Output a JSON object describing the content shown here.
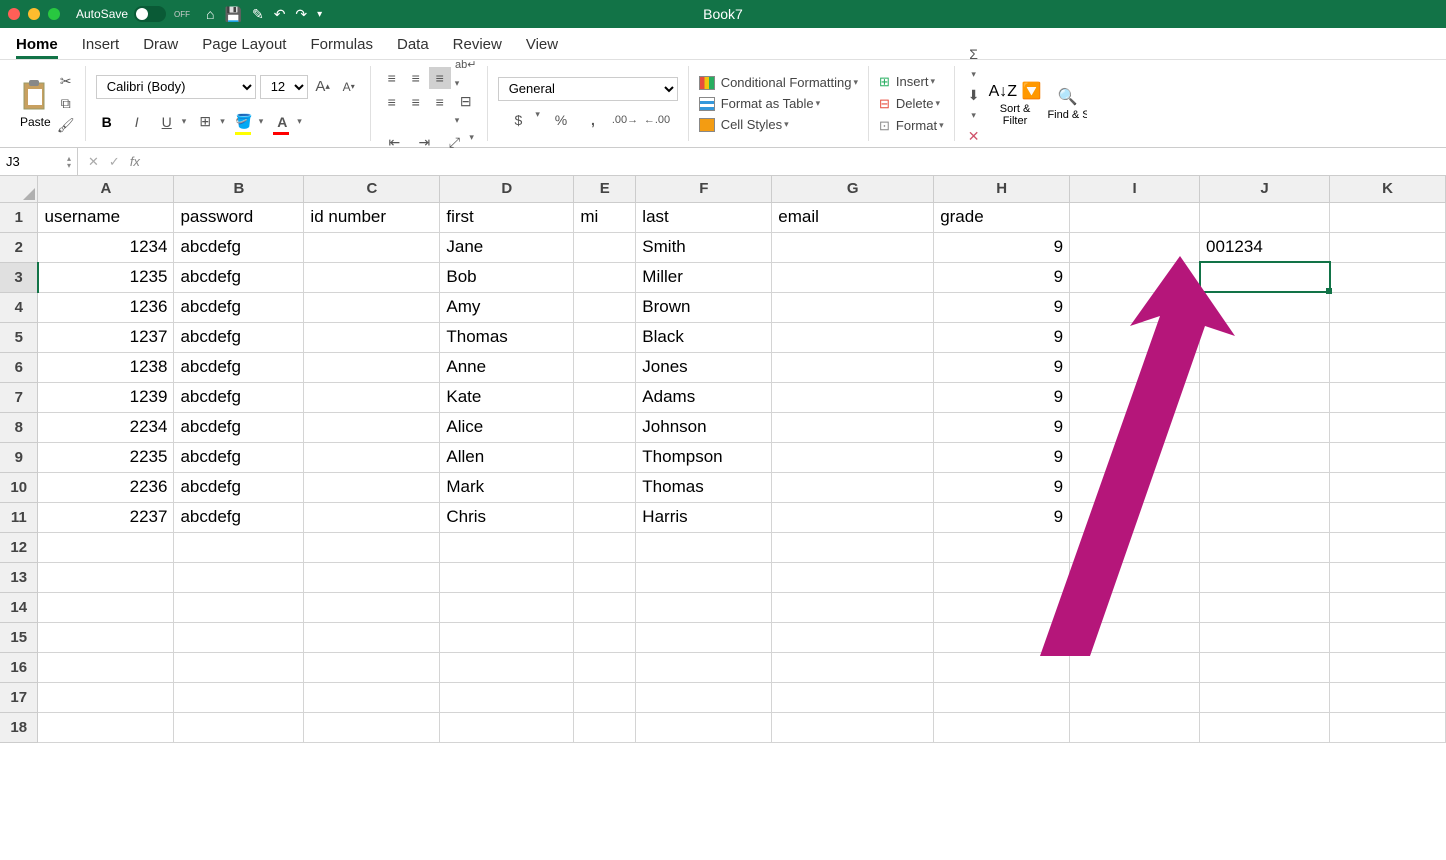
{
  "titlebar": {
    "autosave_label": "AutoSave",
    "autosave_state": "OFF",
    "title": "Book7"
  },
  "tabs": [
    "Home",
    "Insert",
    "Draw",
    "Page Layout",
    "Formulas",
    "Data",
    "Review",
    "View"
  ],
  "active_tab": 0,
  "ribbon": {
    "paste_label": "Paste",
    "font_name": "Calibri (Body)",
    "font_size": "12",
    "number_format": "General",
    "conditional_formatting": "Conditional Formatting",
    "format_as_table": "Format as Table",
    "cell_styles": "Cell Styles",
    "insert": "Insert",
    "delete": "Delete",
    "format": "Format",
    "sort_filter": "Sort & Filter",
    "find_select": "Find & Select"
  },
  "formula": {
    "name_box": "J3",
    "fx": ""
  },
  "columns": [
    "A",
    "B",
    "C",
    "D",
    "E",
    "F",
    "G",
    "H",
    "I",
    "J",
    "K"
  ],
  "row_count": 18,
  "headers_row": [
    "username",
    "password",
    "id number",
    "first",
    "mi",
    "last",
    "email",
    "grade",
    "",
    ""
  ],
  "data_rows": [
    {
      "A": "1234",
      "B": "abcdefg",
      "C": "",
      "D": "Jane",
      "E": "",
      "F": "Smith",
      "G": "",
      "H": "9",
      "I": "",
      "J": "001234"
    },
    {
      "A": "1235",
      "B": "abcdefg",
      "C": "",
      "D": "Bob",
      "E": "",
      "F": "Miller",
      "G": "",
      "H": "9",
      "I": "",
      "J": ""
    },
    {
      "A": "1236",
      "B": "abcdefg",
      "C": "",
      "D": "Amy",
      "E": "",
      "F": "Brown",
      "G": "",
      "H": "9",
      "I": "",
      "J": ""
    },
    {
      "A": "1237",
      "B": "abcdefg",
      "C": "",
      "D": "Thomas",
      "E": "",
      "F": "Black",
      "G": "",
      "H": "9",
      "I": "",
      "J": ""
    },
    {
      "A": "1238",
      "B": "abcdefg",
      "C": "",
      "D": "Anne",
      "E": "",
      "F": "Jones",
      "G": "",
      "H": "9",
      "I": "",
      "J": ""
    },
    {
      "A": "1239",
      "B": "abcdefg",
      "C": "",
      "D": "Kate",
      "E": "",
      "F": "Adams",
      "G": "",
      "H": "9",
      "I": "",
      "J": ""
    },
    {
      "A": "2234",
      "B": "abcdefg",
      "C": "",
      "D": "Alice",
      "E": "",
      "F": "Johnson",
      "G": "",
      "H": "9",
      "I": "",
      "J": ""
    },
    {
      "A": "2235",
      "B": "abcdefg",
      "C": "",
      "D": "Allen",
      "E": "",
      "F": "Thompson",
      "G": "",
      "H": "9",
      "I": "",
      "J": ""
    },
    {
      "A": "2236",
      "B": "abcdefg",
      "C": "",
      "D": "Mark",
      "E": "",
      "F": "Thomas",
      "G": "",
      "H": "9",
      "I": "",
      "J": ""
    },
    {
      "A": "2237",
      "B": "abcdefg",
      "C": "",
      "D": "Chris",
      "E": "",
      "F": "Harris",
      "G": "",
      "H": "9",
      "I": "",
      "J": ""
    }
  ],
  "selected_cell": {
    "row": 3,
    "col": "J"
  },
  "right_align_cols": [
    "A",
    "H"
  ]
}
